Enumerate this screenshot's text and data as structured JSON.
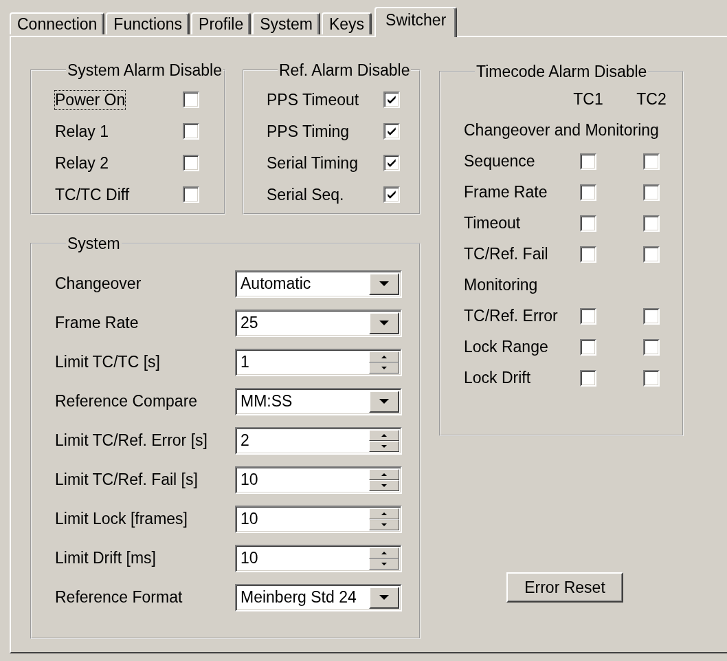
{
  "tabs": [
    {
      "label": "Connection",
      "selected": false
    },
    {
      "label": "Functions",
      "selected": false
    },
    {
      "label": "Profile",
      "selected": false
    },
    {
      "label": "System",
      "selected": false
    },
    {
      "label": "Keys",
      "selected": false
    },
    {
      "label": "Switcher",
      "selected": true
    }
  ],
  "system_alarm_disable": {
    "title": "System Alarm Disable",
    "items": [
      {
        "label": "Power On",
        "checked": false,
        "focused": true
      },
      {
        "label": "Relay 1",
        "checked": false,
        "focused": false
      },
      {
        "label": "Relay 2",
        "checked": false,
        "focused": false
      },
      {
        "label": "TC/TC Diff",
        "checked": false,
        "focused": false
      }
    ]
  },
  "ref_alarm_disable": {
    "title": "Ref. Alarm Disable",
    "items": [
      {
        "label": "PPS Timeout",
        "checked": true,
        "focused": false
      },
      {
        "label": "PPS Timing",
        "checked": true,
        "focused": false
      },
      {
        "label": "Serial Timing",
        "checked": true,
        "focused": false
      },
      {
        "label": "Serial Seq.",
        "checked": true,
        "focused": false
      }
    ]
  },
  "system": {
    "title": "System",
    "fields": [
      {
        "label": "Changeover",
        "kind": "dropdown",
        "value": "Automatic"
      },
      {
        "label": "Frame Rate",
        "kind": "dropdown",
        "value": "25"
      },
      {
        "label": "Limit TC/TC [s]",
        "kind": "spinner",
        "value": "1"
      },
      {
        "label": "Reference Compare",
        "kind": "dropdown",
        "value": "MM:SS"
      },
      {
        "label": "Limit TC/Ref. Error [s]",
        "kind": "spinner",
        "value": "2"
      },
      {
        "label": "Limit TC/Ref. Fail [s]",
        "kind": "spinner",
        "value": "10"
      },
      {
        "label": "Limit Lock [frames]",
        "kind": "spinner",
        "value": "10"
      },
      {
        "label": "Limit Drift [ms]",
        "kind": "spinner",
        "value": "10"
      },
      {
        "label": "Reference Format",
        "kind": "dropdown",
        "value": "Meinberg Std 24"
      }
    ]
  },
  "timecode_alarm_disable": {
    "title": "Timecode Alarm Disable",
    "columns": [
      "TC1",
      "TC2"
    ],
    "sections": [
      {
        "heading": "Changeover and Monitoring",
        "rows": [
          {
            "label": "Sequence",
            "checks": [
              false,
              false
            ]
          },
          {
            "label": "Frame Rate",
            "checks": [
              false,
              false
            ]
          },
          {
            "label": "Timeout",
            "checks": [
              false,
              false
            ]
          },
          {
            "label": "TC/Ref. Fail",
            "checks": [
              false,
              false
            ]
          }
        ]
      },
      {
        "heading": "Monitoring",
        "rows": [
          {
            "label": "TC/Ref. Error",
            "checks": [
              false,
              false
            ]
          },
          {
            "label": "Lock Range",
            "checks": [
              false,
              false
            ]
          },
          {
            "label": "Lock Drift",
            "checks": [
              false,
              false
            ]
          }
        ]
      }
    ]
  },
  "error_reset_button": "Error Reset"
}
